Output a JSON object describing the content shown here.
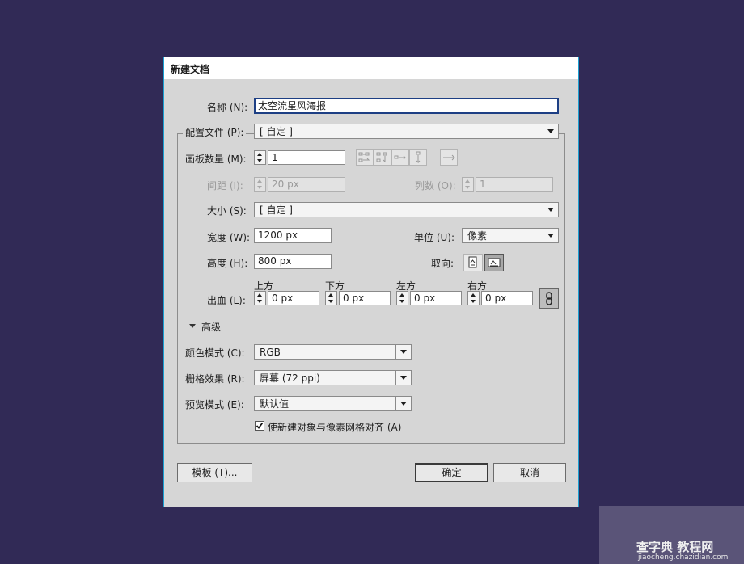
{
  "dialog": {
    "title": "新建文档",
    "name_label": "名称 (N):",
    "name_value": "太空流星风海报",
    "profile_label": "配置文件 (P):",
    "profile_value": "[ 自定 ]",
    "artboards_label": "画板数量 (M):",
    "artboards_value": "1",
    "spacing_label": "间距 (I):",
    "spacing_value": "20 px",
    "columns_label": "列数 (O):",
    "columns_value": "1",
    "size_label": "大小 (S):",
    "size_value": "[ 自定 ]",
    "width_label": "宽度 (W):",
    "width_value": "1200 px",
    "units_label": "单位 (U):",
    "units_value": "像素",
    "height_label": "高度 (H):",
    "height_value": "800 px",
    "orientation_label": "取向:",
    "bleed_label": "出血 (L):",
    "bleed_top_label": "上方",
    "bleed_top_value": "0 px",
    "bleed_bottom_label": "下方",
    "bleed_bottom_value": "0 px",
    "bleed_left_label": "左方",
    "bleed_left_value": "0 px",
    "bleed_right_label": "右方",
    "bleed_right_value": "0 px",
    "advanced_label": "高级",
    "color_mode_label": "颜色模式 (C):",
    "color_mode_value": "RGB",
    "raster_label": "栅格效果 (R):",
    "raster_value": "屏幕 (72 ppi)",
    "preview_label": "预览模式 (E):",
    "preview_value": "默认值",
    "align_pixel_label": "使新建对象与像素网格对齐 (A)",
    "align_pixel_checked": true,
    "templates_button": "模板 (T)...",
    "ok_button": "确定",
    "cancel_button": "取消"
  },
  "watermark": {
    "text": "查字典 教程网",
    "url": "jiaocheng.chazidian.com"
  },
  "colors": {
    "desktop": "#312a56",
    "dialog_bg": "#d6d6d6",
    "dialog_border": "#1a9fd1",
    "focus_border": "#1d3f84"
  },
  "icons": [
    "grid-by-row-icon",
    "grid-by-column-icon",
    "arrange-by-row-icon",
    "arrange-by-column-icon",
    "right-to-left-icon",
    "portrait-icon",
    "landscape-icon",
    "link-bleed-icon",
    "disclosure-triangle-icon",
    "checkbox-checked-icon"
  ]
}
